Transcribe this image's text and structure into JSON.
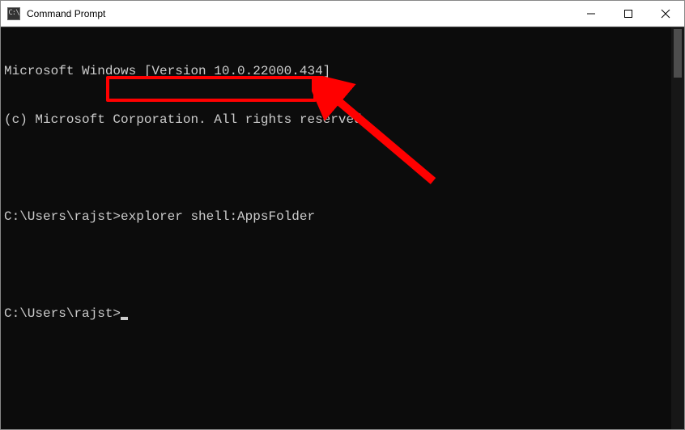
{
  "window": {
    "title": "Command Prompt",
    "icon_name": "cmd-icon",
    "controls": {
      "minimize": "—",
      "maximize": "▢",
      "close": "✕"
    }
  },
  "terminal": {
    "banner_line1": "Microsoft Windows [Version 10.0.22000.434]",
    "banner_line2": "(c) Microsoft Corporation. All rights reserved.",
    "prompt1_path": "C:\\Users\\rajst>",
    "prompt1_cmd": "explorer shell:AppsFolder",
    "prompt2_path": "C:\\Users\\rajst>",
    "prompt2_cmd": ""
  },
  "annotation": {
    "highlight_target": "explorer shell:AppsFolder",
    "arrow_color": "#ff0000"
  }
}
